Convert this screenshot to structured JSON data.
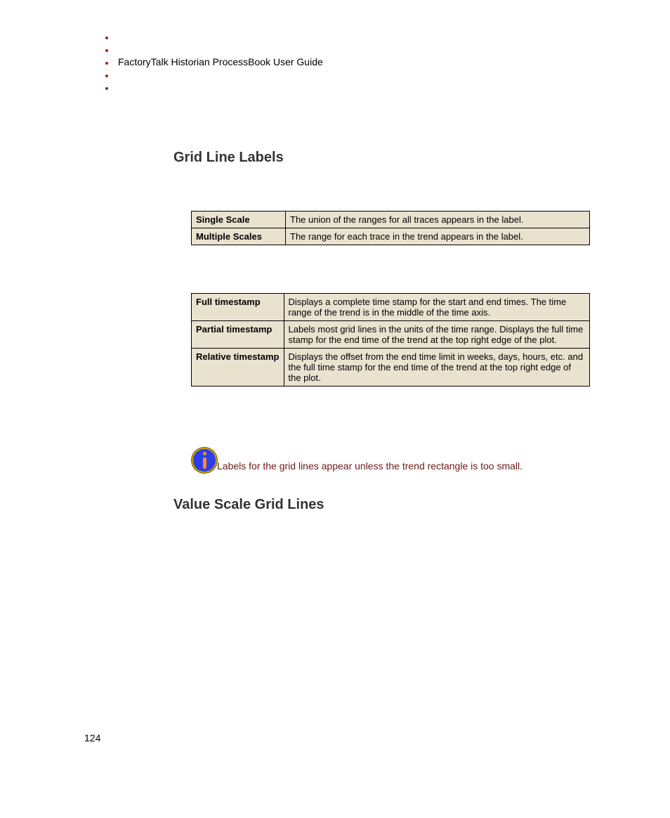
{
  "header": {
    "doc_title": "FactoryTalk Historian ProcessBook User Guide"
  },
  "sections": {
    "grid_line_labels": "Grid Line Labels",
    "value_scale_grid_lines": "Value Scale Grid Lines"
  },
  "table1": {
    "rows": [
      {
        "key": "Single Scale",
        "val": "The union of the ranges for all traces appears in the label."
      },
      {
        "key": "Multiple Scales",
        "val": "The range for each trace in the trend appears in the label."
      }
    ]
  },
  "table2": {
    "rows": [
      {
        "key": "Full timestamp",
        "val": "Displays a complete time stamp for the start and end times. The time range of the trend is in the middle of the time axis."
      },
      {
        "key": "Partial timestamp",
        "val": "Labels most grid lines in the units of the time range. Displays the full time stamp for the end time of the trend at the top right edge of the plot."
      },
      {
        "key": "Relative timestamp",
        "val": "Displays the offset from the end time limit in weeks, days, hours, etc. and the full time stamp for the end time of the trend at the top right edge of the plot."
      }
    ]
  },
  "note": {
    "text": "Labels for the grid lines appear unless the trend rectangle is too small."
  },
  "page_number": "124"
}
